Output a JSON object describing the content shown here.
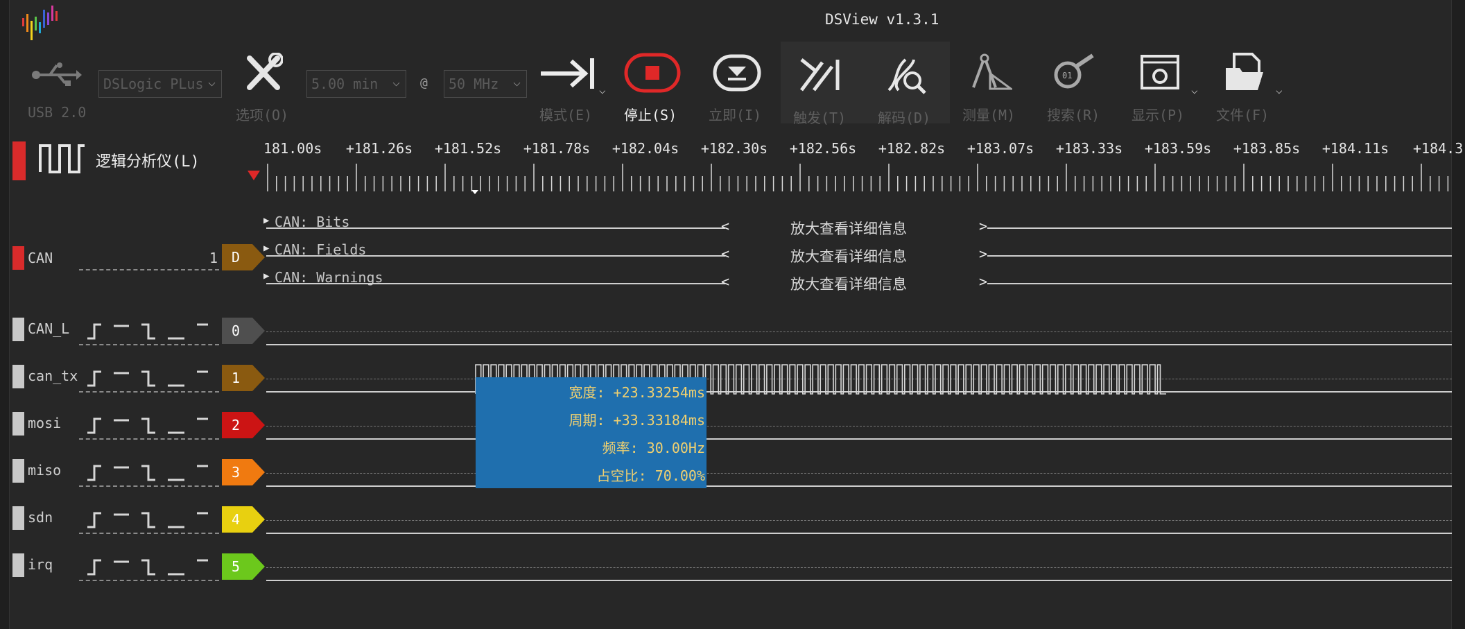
{
  "app": {
    "title": "DSView v1.3.1",
    "colors": {
      "background": "#272727",
      "accent_red": "#d92b2b",
      "measure_bg": "#1f6fae"
    }
  },
  "toolbar": {
    "usb_label": "USB 2.0",
    "device_select": "DSLogic PLus",
    "options_label": "选项(O)",
    "duration_select": "5.00 min",
    "at": "@",
    "samplerate_select": "50 MHz",
    "mode_label": "模式(E)",
    "stop_label": "停止(S)",
    "instant_label": "立即(I)",
    "trigger_label": "触发(T)",
    "decode_label": "解码(D)",
    "measure_label": "测量(M)",
    "search_label": "搜索(R)",
    "display_label": "显示(P)",
    "file_label": "文件(F)"
  },
  "panel": {
    "logic_label": "逻辑分析仪(L)"
  },
  "ruler": {
    "ticks": [
      "181.00s",
      "+181.26s",
      "+181.52s",
      "+181.78s",
      "+182.04s",
      "+182.30s",
      "+182.56s",
      "+182.82s",
      "+183.07s",
      "+183.33s",
      "+183.59s",
      "+183.85s",
      "+184.11s",
      "+184.3"
    ]
  },
  "decoder": {
    "name": "CAN",
    "index": "1",
    "tag": "D",
    "rows": [
      {
        "label": "CAN: Bits",
        "message": "放大查看详细信息"
      },
      {
        "label": "CAN: Fields",
        "message": "放大查看详细信息"
      },
      {
        "label": "CAN: Warnings",
        "message": "放大查看详细信息"
      }
    ]
  },
  "channels": [
    {
      "name": "CAN_L",
      "tag": "0",
      "color": "#4f4f4f"
    },
    {
      "name": "can_tx",
      "tag": "1",
      "color": "#8a5a10"
    },
    {
      "name": "mosi",
      "tag": "2",
      "color": "#cc1414"
    },
    {
      "name": "miso",
      "tag": "3",
      "color": "#f07a10"
    },
    {
      "name": "sdn",
      "tag": "4",
      "color": "#e8d010"
    },
    {
      "name": "irq",
      "tag": "5",
      "color": "#6cc81c"
    }
  ],
  "measurement": {
    "width": "宽度: +23.33254ms",
    "period": "周期: +33.33184ms",
    "frequency": "频率: 30.00Hz",
    "duty": "占空比: 70.00%"
  }
}
